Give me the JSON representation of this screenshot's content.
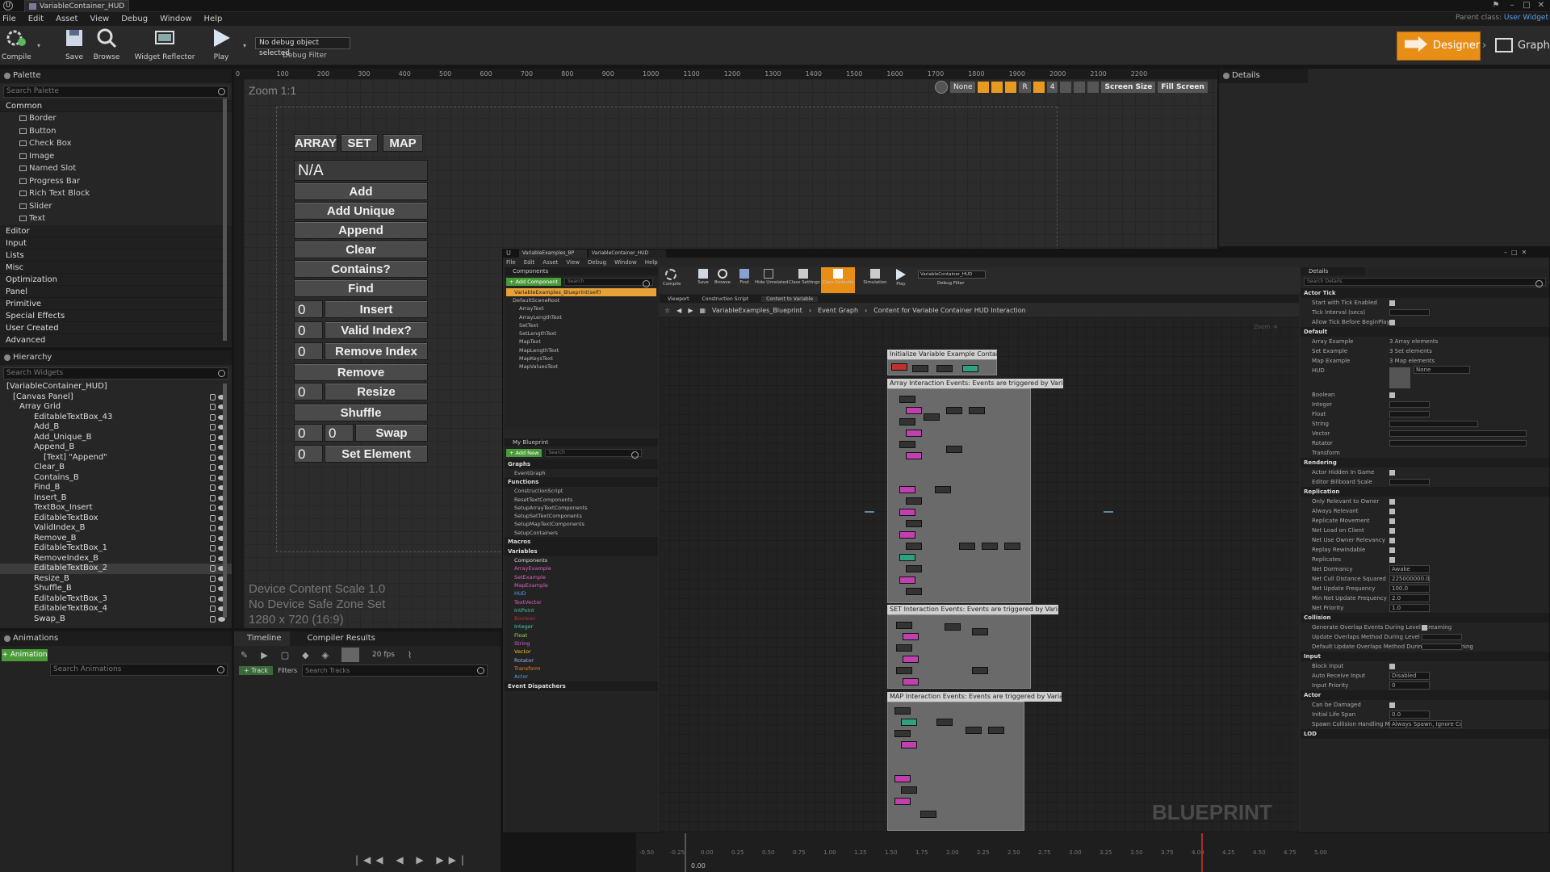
{
  "window": {
    "tab_title": "VariableContainer_HUD",
    "parent_class_label": "Parent class:",
    "parent_class_value": "User Widget"
  },
  "menu": [
    "File",
    "Edit",
    "Asset",
    "View",
    "Debug",
    "Window",
    "Help"
  ],
  "toolbar": {
    "compile": "Compile",
    "save": "Save",
    "browse": "Browse",
    "widget_reflector": "Widget Reflector",
    "play": "Play",
    "debug_object": "No debug object selected",
    "debug_filter": "Debug Filter",
    "designer": "Designer",
    "graph": "Graph"
  },
  "palette": {
    "title": "Palette",
    "search_placeholder": "Search Palette",
    "common": "Common",
    "items": [
      "Border",
      "Button",
      "Check Box",
      "Image",
      "Named Slot",
      "Progress Bar",
      "Rich Text Block",
      "Slider",
      "Text"
    ],
    "categories": [
      "Editor",
      "Input",
      "Lists",
      "Misc",
      "Optimization",
      "Panel",
      "Primitive",
      "Special Effects",
      "User Created",
      "Advanced"
    ]
  },
  "hierarchy": {
    "title": "Hierarchy",
    "search_placeholder": "Search Widgets",
    "items": [
      "[VariableContainer_HUD]",
      "[Canvas Panel]",
      "Array Grid",
      "EditableTextBox_43",
      "Add_B",
      "Add_Unique_B",
      "Append_B",
      "[Text] \"Append\"",
      "Clear_B",
      "Contains_B",
      "Find_B",
      "Insert_B",
      "TextBox_Insert",
      "EditableTextBox",
      "ValidIndex_B",
      "Remove_B",
      "EditableTextBox_1",
      "RemoveIndex_B",
      "EditableTextBox_2",
      "Resize_B",
      "Shuffle_B",
      "EditableTextBox_3",
      "EditableTextBox_4",
      "Swap_B"
    ]
  },
  "animations": {
    "title": "Animations",
    "add_label": "+ Animation",
    "search_placeholder": "Search Animations"
  },
  "timeline": {
    "tab": "Timeline",
    "compiler_tab": "Compiler Results",
    "fps": "20 fps",
    "track": "+ Track",
    "filters": "Filters",
    "search_placeholder": "Search Tracks",
    "time": "0.00"
  },
  "ruler_ticks": [
    "0",
    "100",
    "200",
    "300",
    "400",
    "500",
    "600",
    "700",
    "800",
    "900",
    "1000",
    "1100",
    "1200",
    "1300",
    "1400",
    "1500",
    "1600",
    "1700",
    "1800",
    "1900",
    "2000",
    "2100",
    "2200"
  ],
  "canvas": {
    "zoom": "Zoom 1:1",
    "none": "None",
    "r": "R",
    "four": "4",
    "screen_size": "Screen Size",
    "fill_screen": "Fill Screen",
    "scale": "Device Content Scale 1.0",
    "safe_zone": "No Device Safe Zone Set",
    "resolution": "1280 x 720 (16:9)"
  },
  "hud": {
    "tabs": [
      "ARRAY",
      "SET",
      "MAP"
    ],
    "display": "N/A",
    "buttons": [
      "Add",
      "Add Unique",
      "Append",
      "Clear",
      "Contains?",
      "Find"
    ],
    "insert": {
      "idx": "0",
      "label": "Insert"
    },
    "valid": {
      "idx": "0",
      "label": "Valid Index?"
    },
    "remove_index": {
      "idx": "0",
      "label": "Remove Index"
    },
    "remove": "Remove",
    "resize": {
      "idx": "0",
      "label": "Resize"
    },
    "shuffle": "Shuffle",
    "swap": {
      "a": "0",
      "b": "0",
      "label": "Swap"
    },
    "set_element": {
      "idx": "0",
      "label": "Set Element"
    }
  },
  "details": {
    "title": "Details"
  },
  "blueprint": {
    "tabs": [
      "VariableExamples_BP",
      "VariableContainer_HUD"
    ],
    "menu": [
      "File",
      "Edit",
      "Asset",
      "View",
      "Debug",
      "Window",
      "Help"
    ],
    "components": "Components",
    "add_component": "+ Add Component",
    "search": "Search",
    "self": "VariableExamples_Blueprint(self)",
    "comp_items": [
      "DefaultSceneRoot",
      "ArrayText",
      "ArrayLengthText",
      "SetText",
      "SetLengthText",
      "MapText",
      "MapLengthText",
      "MapKeysText",
      "MapValuesText"
    ],
    "my_blueprint": "My Blueprint",
    "add_new": "+ Add New",
    "graphs_h": "Graphs",
    "event_graph": "EventGraph",
    "functions_h": "Functions",
    "functions": [
      "ConstructionScript",
      "ResetTextComponents",
      "SetupArrayTextComponents",
      "SetupSetTextComponents",
      "SetupMapTextComponents",
      "SetupContainers"
    ],
    "macros_h": "Macros",
    "variables_h": "Variables",
    "components_h": "Components",
    "variables": [
      "ArrayExample",
      "SetExample",
      "MapExample",
      "HUD",
      "TextVector",
      "IntPoint",
      "Boolean",
      "Integer",
      "Float",
      "String",
      "Vector",
      "Rotator",
      "Transform",
      "Actor"
    ],
    "dispatchers_h": "Event Dispatchers",
    "tb": [
      "Compile",
      "Save",
      "Browse",
      "Find",
      "Hide Unrelated",
      "Class Settings",
      "Class Defaults",
      "Simulation",
      "Play"
    ],
    "debug": "VariableContainer_HUD",
    "debug_filter": "Debug Filter",
    "graph_tabs": [
      "Viewport",
      "Construction Script",
      "Content to Variable"
    ],
    "breadcrumb": [
      "VariableExamples_Blueprint",
      "Event Graph",
      "Content for Variable Container HUD Interaction"
    ],
    "zoom": "Zoom -4",
    "comments": [
      "Initialize Variable Example Container HUD",
      "Array Interaction Events: Events are triggered by VariableContainer_HUD",
      "SET Interaction Events: Events are triggered by VariableContainer_HUD",
      "MAP Interaction Events: Events are triggered by VariableContainer_HUD"
    ],
    "watermark": "BLUEPRINT",
    "details_title": "Details",
    "details_search": "Search Details",
    "details_cats": [
      "Actor Tick",
      "Default",
      "Rendering",
      "Replication",
      "Collision",
      "Input",
      "Actor",
      "LOD"
    ],
    "d_tick": [
      "Start with Tick Enabled",
      "Tick Interval (secs)",
      "Allow Tick Before BeginPlay"
    ],
    "d_default": [
      "Array Example",
      "Set Example",
      "Map Example",
      "HUD",
      "Boolean",
      "Integer",
      "Float",
      "String",
      "Vector",
      "Rotator",
      "Transform"
    ],
    "d_default_vals": [
      "3 Array elements",
      "3 Set elements",
      "3 Map elements",
      "None"
    ],
    "d_render": [
      "Actor Hidden In Game",
      "Editor Billboard Scale"
    ],
    "d_rep": [
      "Only Relevant to Owner",
      "Always Relevant",
      "Replicate Movement",
      "Net Load on Client",
      "Net Use Owner Relevancy",
      "Replay Rewindable",
      "Replicates",
      "Net Dormancy",
      "Net Cull Distance Squared",
      "Net Update Frequency",
      "Min Net Update Frequency",
      "Net Priority"
    ],
    "d_rep_vals": [
      "Awake",
      "225000000.0",
      "100.0",
      "2.0",
      "1.0"
    ],
    "d_coll": [
      "Generate Overlap Events During Level Streaming",
      "Update Overlaps Method During Level Streaming",
      "Default Update Overlaps Method During Level Streaming"
    ],
    "d_input": [
      "Block Input",
      "Auto Receive Input",
      "Input Priority"
    ],
    "d_input_vals": [
      "Disabled",
      "0"
    ],
    "d_actor": [
      "Can be Damaged",
      "Initial Life Span",
      "Spawn Collision Handling Method"
    ],
    "d_actor_vals": [
      "0.0",
      "Always Spawn, Ignore Collisions"
    ],
    "tl_ticks": [
      "-0.50",
      "-0.25",
      "0.00",
      "0.25",
      "0.50",
      "0.75",
      "1.00",
      "1.25",
      "1.50",
      "1.75",
      "2.00",
      "2.25",
      "2.50",
      "2.75",
      "3.00",
      "3.25",
      "3.50",
      "3.75",
      "4.00",
      "4.25",
      "4.50",
      "4.75",
      "5.00"
    ],
    "tl_value": "0.00"
  }
}
